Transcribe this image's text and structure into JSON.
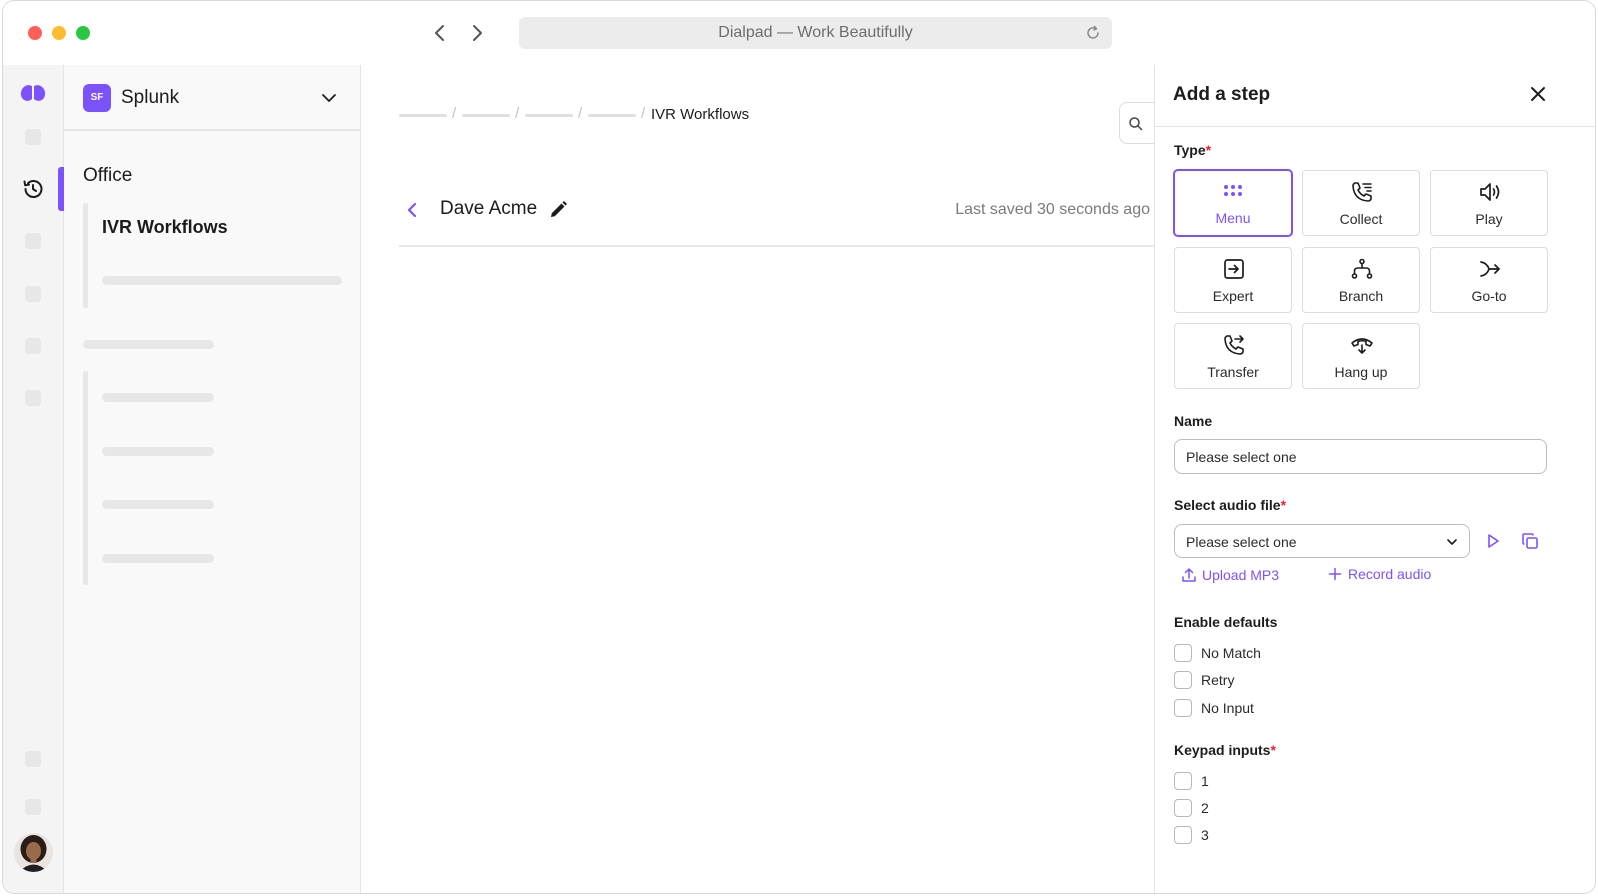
{
  "browser": {
    "url_title": "Dialpad — Work Beautifully"
  },
  "colors": {
    "accent": "#7c52ff",
    "required": "#e5243b"
  },
  "sidebar": {
    "org_initials": "SF",
    "org_name": "Splunk",
    "section_title": "Office",
    "active_item": "IVR Workflows"
  },
  "main": {
    "breadcrumb_current": "IVR Workflows",
    "flow_name": "Dave Acme",
    "last_saved": "Last saved 30 seconds ago"
  },
  "panel": {
    "title": "Add a step",
    "type_label": "Type",
    "required_mark": "*",
    "types": [
      {
        "label": "Menu",
        "icon": "dots-grid-icon",
        "selected": true
      },
      {
        "label": "Collect",
        "icon": "phone-list-icon",
        "selected": false
      },
      {
        "label": "Play",
        "icon": "speaker-icon",
        "selected": false
      },
      {
        "label": "Expert",
        "icon": "enter-box-icon",
        "selected": false
      },
      {
        "label": "Branch",
        "icon": "branch-icon",
        "selected": false
      },
      {
        "label": "Go-to",
        "icon": "merge-arrow-icon",
        "selected": false
      },
      {
        "label": "Transfer",
        "icon": "phone-transfer-icon",
        "selected": false
      },
      {
        "label": "Hang up",
        "icon": "hang-up-icon",
        "selected": false
      }
    ],
    "name_label": "Name",
    "name_value": "Please select one",
    "audio_label": "Select audio file",
    "audio_value": "Please select one",
    "upload_label": "Upload MP3",
    "record_label": "Record audio",
    "defaults_label": "Enable defaults",
    "defaults": [
      "No Match",
      "Retry",
      "No Input"
    ],
    "keypad_label": "Keypad inputs",
    "keypad": [
      "1",
      "2",
      "3"
    ]
  }
}
